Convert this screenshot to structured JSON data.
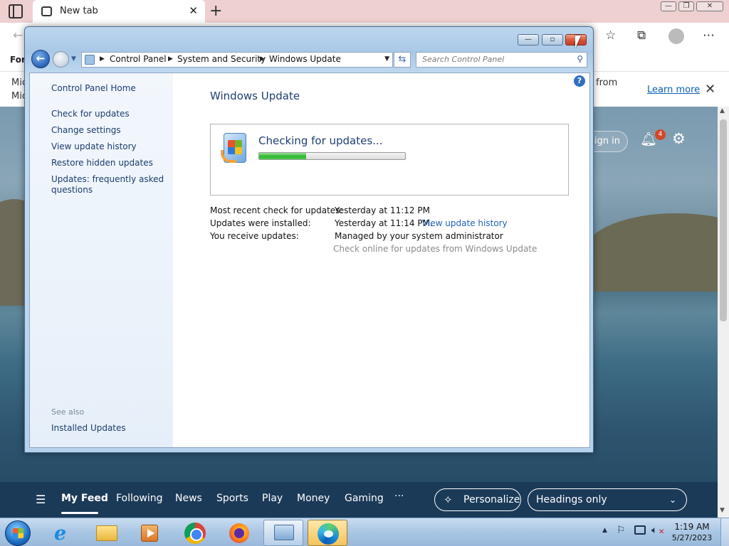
{
  "browser": {
    "tab": {
      "title": "New tab"
    },
    "infobar": {
      "line1": "Mic",
      "line2": "Mic",
      "from_text": "from",
      "learn_more": "Learn more"
    },
    "favbar": {
      "label": "For"
    },
    "newtab": {
      "sign_in": "Sign in",
      "notification_count": "4"
    },
    "feed": {
      "items": [
        "My Feed",
        "Following",
        "News",
        "Sports",
        "Play",
        "Money",
        "Gaming",
        "···"
      ],
      "active": "My Feed",
      "personalize": "Personalize",
      "headings": "Headings only"
    }
  },
  "window": {
    "breadcrumbs": [
      "Control Panel",
      "System and Security",
      "Windows Update"
    ],
    "search_placeholder": "Search Control Panel",
    "left_nav": {
      "home": "Control Panel Home",
      "links": [
        "Check for updates",
        "Change settings",
        "View update history",
        "Restore hidden updates",
        "Updates: frequently asked questions"
      ],
      "see_also_heading": "See also",
      "see_also_links": [
        "Installed Updates"
      ]
    },
    "title": "Windows Update",
    "status": {
      "text": "Checking for updates...",
      "progress": 0.32
    },
    "info": {
      "recent_check_label": "Most recent check for updates:",
      "recent_check_value": "Yesterday at 11:12 PM",
      "installed_label": "Updates were installed:",
      "installed_value": "Yesterday at 11:14 PM.",
      "installed_link": "View update history",
      "receive_label": "You receive updates:",
      "receive_value": "Managed by your system administrator",
      "check_online": "Check online for updates from Windows Update"
    }
  },
  "taskbar": {
    "clock": {
      "time": "1:19 AM",
      "date": "5/27/2023"
    }
  },
  "colors": {
    "link": "#1c3c6e",
    "title": "#1e3f74",
    "progress": "#2fb52f",
    "feed_bar": "#1b3a58",
    "tabstrip": "#eed0d0"
  }
}
